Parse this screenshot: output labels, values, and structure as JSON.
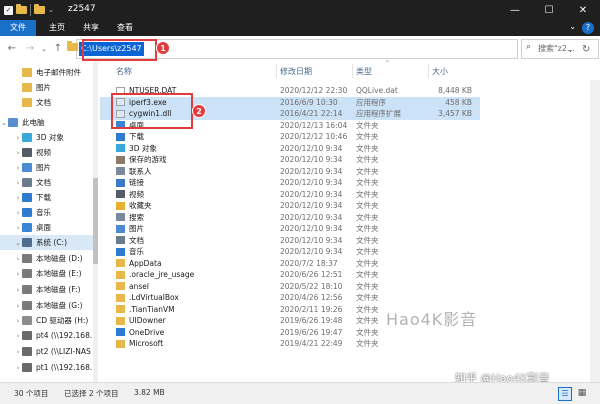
{
  "window": {
    "title": "z2547",
    "minimize_glyph": "—",
    "maximize_glyph": "☐",
    "close_glyph": "✕"
  },
  "ribbon": {
    "tabs": [
      "文件",
      "主页",
      "共享",
      "查看"
    ],
    "expand_glyph": "⌄",
    "help_glyph": "?"
  },
  "nav": {
    "back_glyph": "←",
    "forward_glyph": "→",
    "recent_glyph": "⌄",
    "up_glyph": "↑",
    "address": "C:\\Users\\z2547",
    "address_dropdown_glyph": "⌄",
    "refresh_glyph": "↻",
    "search_placeholder": "搜索\"z2...",
    "search_glyph": "⌕"
  },
  "annotations": {
    "badge1": "1",
    "badge2": "2"
  },
  "sidebar": {
    "items": [
      {
        "label": "电子邮件附件",
        "icon": "folder-icon"
      },
      {
        "label": "图片",
        "icon": "folder-icon"
      },
      {
        "label": "文档",
        "icon": "folder-icon"
      },
      {
        "label": "此电脑",
        "icon": "computer-icon"
      },
      {
        "label": "3D 对象",
        "icon": "3d-objects-icon"
      },
      {
        "label": "视频",
        "icon": "videos-icon"
      },
      {
        "label": "图片",
        "icon": "pictures-icon"
      },
      {
        "label": "文档",
        "icon": "documents-icon"
      },
      {
        "label": "下载",
        "icon": "download-icon"
      },
      {
        "label": "音乐",
        "icon": "music-icon"
      },
      {
        "label": "桌面",
        "icon": "desktop-icon"
      },
      {
        "label": "系统 (C:)",
        "icon": "system-drive-icon"
      },
      {
        "label": "本地磁盘 (D:)",
        "icon": "drive-icon"
      },
      {
        "label": "本地磁盘 (E:)",
        "icon": "drive-icon"
      },
      {
        "label": "本地磁盘 (F:)",
        "icon": "drive-icon"
      },
      {
        "label": "本地磁盘 (G:)",
        "icon": "drive-icon"
      },
      {
        "label": "CD 驱动器 (H:)",
        "icon": "cd-drive-icon"
      },
      {
        "label": "pt4 (\\\\192.168.",
        "icon": "network-drive-icon"
      },
      {
        "label": "pt2 (\\\\LIZI-NAS",
        "icon": "network-drive-icon"
      },
      {
        "label": "pt1 (\\\\192.168.1",
        "icon": "network-drive-icon"
      }
    ]
  },
  "columns": {
    "name": "名称",
    "date": "修改日期",
    "type": "类型",
    "size": "大小",
    "sort_glyph": "^"
  },
  "files": [
    {
      "name": "NTUSER.DAT",
      "date": "2020/12/12 22:30",
      "type": "QQLive.dat",
      "size": "8,448 KB",
      "icon": "file-icon"
    },
    {
      "name": "iperf3.exe",
      "date": "2016/6/9 10:30",
      "type": "应用程序",
      "size": "458 KB",
      "icon": "exe-icon"
    },
    {
      "name": "cygwin1.dll",
      "date": "2016/4/21 22:14",
      "type": "应用程序扩展",
      "size": "3,457 KB",
      "icon": "dll-icon"
    },
    {
      "name": "桌面",
      "date": "2020/12/13 16:04",
      "type": "文件夹",
      "size": "",
      "icon": "desktop-icon"
    },
    {
      "name": "下载",
      "date": "2020/12/12 10:46",
      "type": "文件夹",
      "size": "",
      "icon": "download-icon"
    },
    {
      "name": "3D 对象",
      "date": "2020/12/10 9:34",
      "type": "文件夹",
      "size": "",
      "icon": "3d-objects-icon"
    },
    {
      "name": "保存的游戏",
      "date": "2020/12/10 9:34",
      "type": "文件夹",
      "size": "",
      "icon": "saved-games-icon"
    },
    {
      "name": "联系人",
      "date": "2020/12/10 9:34",
      "type": "文件夹",
      "size": "",
      "icon": "contacts-icon"
    },
    {
      "name": "链接",
      "date": "2020/12/10 9:34",
      "type": "文件夹",
      "size": "",
      "icon": "links-icon"
    },
    {
      "name": "视频",
      "date": "2020/12/10 9:34",
      "type": "文件夹",
      "size": "",
      "icon": "videos-icon"
    },
    {
      "name": "收藏夹",
      "date": "2020/12/10 9:34",
      "type": "文件夹",
      "size": "",
      "icon": "favorites-icon"
    },
    {
      "name": "搜索",
      "date": "2020/12/10 9:34",
      "type": "文件夹",
      "size": "",
      "icon": "search-folder-icon"
    },
    {
      "name": "图片",
      "date": "2020/12/10 9:34",
      "type": "文件夹",
      "size": "",
      "icon": "pictures-icon"
    },
    {
      "name": "文档",
      "date": "2020/12/10 9:34",
      "type": "文件夹",
      "size": "",
      "icon": "documents-icon"
    },
    {
      "name": "音乐",
      "date": "2020/12/10 9:34",
      "type": "文件夹",
      "size": "",
      "icon": "music-icon"
    },
    {
      "name": "AppData",
      "date": "2020/7/2 18:37",
      "type": "文件夹",
      "size": "",
      "icon": "folder-icon"
    },
    {
      "name": ".oracle_jre_usage",
      "date": "2020/6/26 12:51",
      "type": "文件夹",
      "size": "",
      "icon": "folder-icon"
    },
    {
      "name": "ansel",
      "date": "2020/5/22 18:10",
      "type": "文件夹",
      "size": "",
      "icon": "folder-icon"
    },
    {
      "name": ".LdVirtualBox",
      "date": "2020/4/26 12:56",
      "type": "文件夹",
      "size": "",
      "icon": "folder-icon"
    },
    {
      "name": ".TianTianVM",
      "date": "2020/2/11 19:26",
      "type": "文件夹",
      "size": "",
      "icon": "folder-icon"
    },
    {
      "name": "UIDowner",
      "date": "2019/6/26 19:48",
      "type": "文件夹",
      "size": "",
      "icon": "folder-icon"
    },
    {
      "name": "OneDrive",
      "date": "2019/6/26 19:47",
      "type": "文件夹",
      "size": "",
      "icon": "onedrive-icon"
    },
    {
      "name": "Microsoft",
      "date": "2019/4/21 22:49",
      "type": "文件夹",
      "size": "",
      "icon": "folder-icon"
    }
  ],
  "watermark": {
    "text1": "Hao4K影音",
    "text2": "知乎 @Hao4K影音"
  },
  "status": {
    "count": "30 个项目",
    "selected": "已选择 2 个项目",
    "size": "3.82 MB"
  },
  "colors": {
    "accent": "#1a6fc8",
    "annotation": "#e23b3b",
    "selection": "#cce2f7",
    "folder": "#e8b84a"
  }
}
